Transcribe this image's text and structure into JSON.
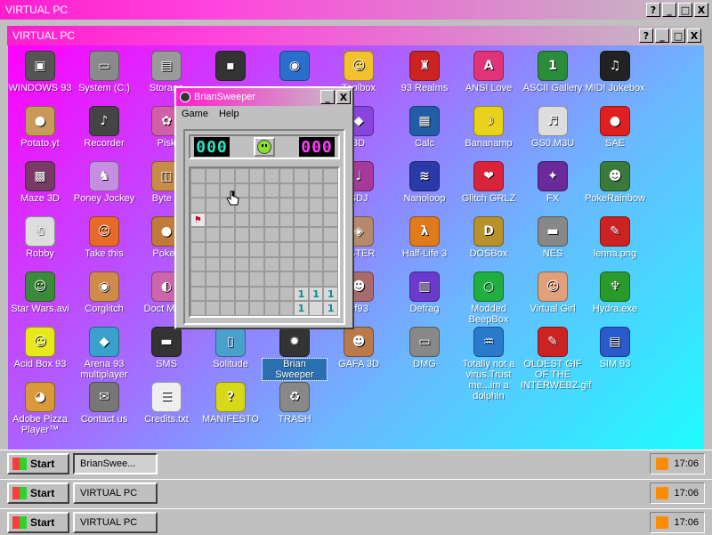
{
  "window": {
    "title": "VIRTUAL PC",
    "inner_title": "VIRTUAL PC",
    "help": "?",
    "minimize": "_",
    "maximize": "□",
    "close": "X"
  },
  "icons": [
    {
      "label": "WINDOWS 93",
      "glyph": "▣",
      "color": "#555"
    },
    {
      "label": "System (C:)",
      "glyph": "▭",
      "color": "#8a8a8a"
    },
    {
      "label": "Storage",
      "glyph": "▤",
      "color": "#9a9a9a"
    },
    {
      "label": "",
      "glyph": "▪",
      "color": "#333"
    },
    {
      "label": "",
      "glyph": "◉",
      "color": "#2a6fcc"
    },
    {
      "label": "Toolbox",
      "glyph": "☺",
      "color": "#f2c12e"
    },
    {
      "label": "93 Realms",
      "glyph": "♜",
      "color": "#cc2222"
    },
    {
      "label": "ANSI Love",
      "glyph": "A",
      "color": "#e0337a"
    },
    {
      "label": "ASCII Gallery",
      "glyph": "1",
      "color": "#2b8c3a"
    },
    {
      "label": "MIDI Jukebox",
      "glyph": "♫",
      "color": "#222"
    },
    {
      "label": "Potato.yt",
      "glyph": "●",
      "color": "#c79a5a"
    },
    {
      "label": "Recorder",
      "glyph": "♪",
      "color": "#444"
    },
    {
      "label": "Pisk",
      "glyph": "✿",
      "color": "#d15fa8"
    },
    {
      "label": "3D",
      "glyph": "◆",
      "color": "#8844dd"
    },
    {
      "label": "Calc",
      "glyph": "▦",
      "color": "#225ea8"
    },
    {
      "label": "Bananamp",
      "glyph": "☽",
      "color": "#e8d21a"
    },
    {
      "label": "GS0.M3U",
      "glyph": "♬",
      "color": "#ddd"
    },
    {
      "label": "SAE",
      "glyph": "●",
      "color": "#e02020"
    },
    {
      "label": "Maze 3D",
      "glyph": "▩",
      "color": "#7a3a66"
    },
    {
      "label": "Poney Jockey",
      "glyph": "♞",
      "color": "#c58ee0"
    },
    {
      "label": "Byte B",
      "glyph": "◫",
      "color": "#c98b4a"
    },
    {
      "label": "SDJ",
      "glyph": "♩",
      "color": "#a53a9a"
    },
    {
      "label": "Nanoloop",
      "glyph": "≋",
      "color": "#2a3aa8"
    },
    {
      "label": "Glitch GRLZ",
      "glyph": "❤",
      "color": "#d9233a"
    },
    {
      "label": "FX",
      "glyph": "✦",
      "color": "#6a2a9a"
    },
    {
      "label": "PokeRainbow",
      "glyph": "☻",
      "color": "#3a7a3a"
    },
    {
      "label": "Robby",
      "glyph": "☃",
      "color": "#ddd"
    },
    {
      "label": "Take this",
      "glyph": "☺",
      "color": "#e86a2a"
    },
    {
      "label": "Pokeg",
      "glyph": "●",
      "color": "#c07a3a"
    },
    {
      "label": "PSTER",
      "glyph": "◈",
      "color": "#b58a6a"
    },
    {
      "label": "Half-Life 3",
      "glyph": "λ",
      "color": "#e07a1a"
    },
    {
      "label": "DOSBox",
      "glyph": "D",
      "color": "#b8912a"
    },
    {
      "label": "NES",
      "glyph": "▬",
      "color": "#888"
    },
    {
      "label": "lenna.png",
      "glyph": "✎",
      "color": "#cc2222"
    },
    {
      "label": "Star Wars.avi",
      "glyph": "☺",
      "color": "#3a8a3a"
    },
    {
      "label": "Corglitch",
      "glyph": "◉",
      "color": "#d08a4a"
    },
    {
      "label": "Doct Marb",
      "glyph": "◐",
      "color": "#cc66aa"
    },
    {
      "label": "of93",
      "glyph": "☻",
      "color": "#a86a6a"
    },
    {
      "label": "Defrag",
      "glyph": "▥",
      "color": "#6a3acc"
    },
    {
      "label": "Modded BeepBox",
      "glyph": "○",
      "color": "#1fae3f"
    },
    {
      "label": "Virtual Girl",
      "glyph": "☺",
      "color": "#e0a07a"
    },
    {
      "label": "Hydra.exe",
      "glyph": "♆",
      "color": "#2a9a2a"
    },
    {
      "label": "Acid Box 93",
      "glyph": "☺",
      "color": "#e8e81a"
    },
    {
      "label": "Arena 93 multiplayer",
      "glyph": "◆",
      "color": "#3aa0cc"
    },
    {
      "label": "SMS",
      "glyph": "▬",
      "color": "#333"
    },
    {
      "label": "Solitude",
      "glyph": "▯",
      "color": "#4aa0cc"
    },
    {
      "label": "Brian Sweeper",
      "glyph": "✹",
      "color": "#333"
    },
    {
      "label": "GAFA 3D",
      "glyph": "☻",
      "color": "#b87a4a"
    },
    {
      "label": "DMG",
      "glyph": "▭",
      "color": "#888"
    },
    {
      "label": "Totally not a virus.Trust me...im a dolphin",
      "glyph": "♒",
      "color": "#2a7acc"
    },
    {
      "label": "OLDEST GIF OF THE INTERWEBZ.gif",
      "glyph": "✎",
      "color": "#cc2222"
    },
    {
      "label": "SIM 93",
      "glyph": "▤",
      "color": "#2a5acc"
    },
    {
      "label": "Adobe Pizza Player™",
      "glyph": "◕",
      "color": "#d89a3a"
    },
    {
      "label": "Contact us",
      "glyph": "✉",
      "color": "#777"
    },
    {
      "label": "Credits.txt",
      "glyph": "☰",
      "color": "#eee"
    },
    {
      "label": "MANIFESTO",
      "glyph": "?",
      "color": "#d8d81a"
    },
    {
      "label": "TRASH",
      "glyph": "♻",
      "color": "#888"
    }
  ],
  "sweeper": {
    "title": "BrianSweeper",
    "menu": [
      "Game",
      "Help"
    ],
    "mines_left": "000",
    "timer": "000",
    "cell_number": "1",
    "flag": "⚑"
  },
  "taskbars": [
    {
      "start": "Start",
      "item": "BrianSwee...",
      "time": "17:06"
    },
    {
      "start": "Start",
      "item": "VIRTUAL PC",
      "time": "17:06"
    },
    {
      "start": "Start",
      "item": "VIRTUAL PC",
      "time": "17:06"
    }
  ]
}
